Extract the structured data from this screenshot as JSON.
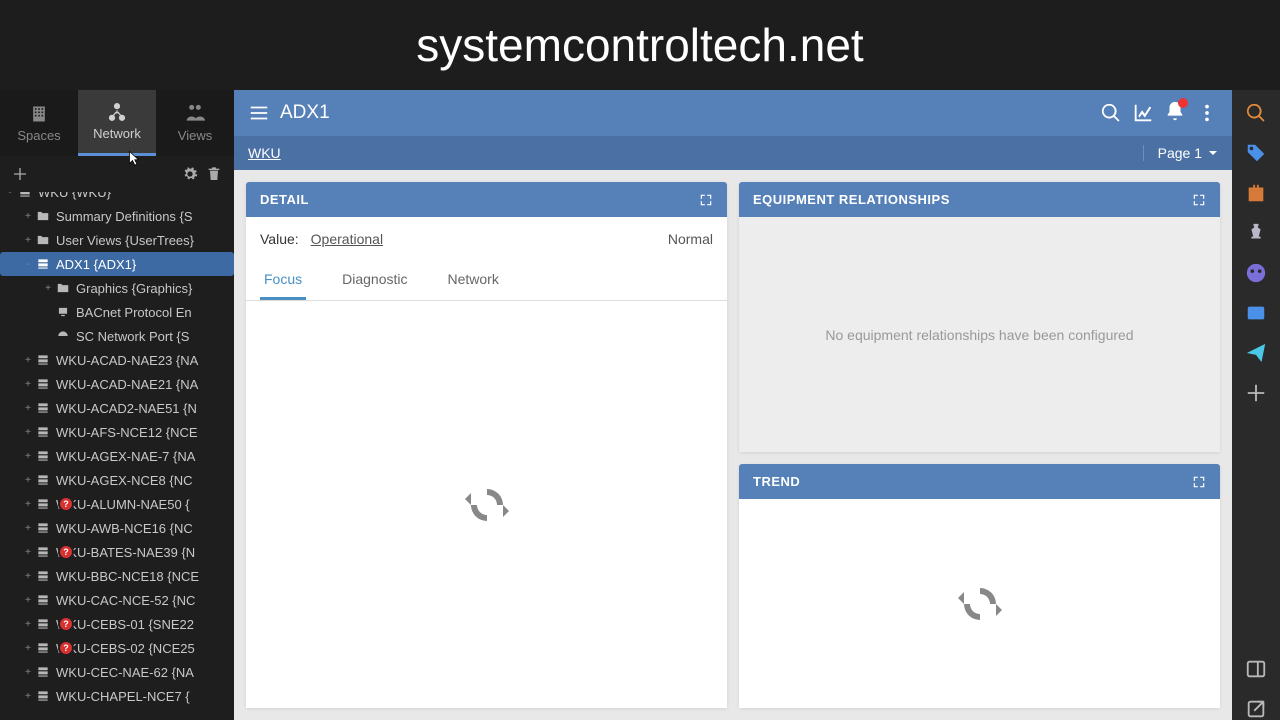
{
  "watermark": "systemcontroltech.net",
  "nav": {
    "spaces": "Spaces",
    "network": "Network",
    "views": "Views"
  },
  "tree": {
    "root": "WKU {WKU}",
    "items": [
      {
        "label": "Summary Definitions {S",
        "icon": "folder",
        "lvl": 1,
        "toggle": "+"
      },
      {
        "label": "User Views {UserTrees}",
        "icon": "folder",
        "lvl": 1,
        "toggle": "+"
      },
      {
        "label": "ADX1 {ADX1}",
        "icon": "server",
        "lvl": 1,
        "toggle": "-",
        "selected": true
      },
      {
        "label": "Graphics {Graphics}",
        "icon": "folder",
        "lvl": 2,
        "toggle": "+"
      },
      {
        "label": "BACnet Protocol En",
        "icon": "device",
        "lvl": 2,
        "toggle": ""
      },
      {
        "label": "SC Network Port {S",
        "icon": "gauge",
        "lvl": 2,
        "toggle": ""
      },
      {
        "label": "WKU-ACAD-NAE23 {NA",
        "icon": "server",
        "lvl": 1,
        "toggle": "+"
      },
      {
        "label": "WKU-ACAD-NAE21 {NA",
        "icon": "server",
        "lvl": 1,
        "toggle": "+"
      },
      {
        "label": "WKU-ACAD2-NAE51 {N",
        "icon": "server",
        "lvl": 1,
        "toggle": "+"
      },
      {
        "label": "WKU-AFS-NCE12 {NCE",
        "icon": "server",
        "lvl": 1,
        "toggle": "+"
      },
      {
        "label": "WKU-AGEX-NAE-7 {NA",
        "icon": "server",
        "lvl": 1,
        "toggle": "+"
      },
      {
        "label": "WKU-AGEX-NCE8 {NC",
        "icon": "server",
        "lvl": 1,
        "toggle": "+"
      },
      {
        "label": "WKU-ALUMN-NAE50 {",
        "icon": "server",
        "lvl": 1,
        "toggle": "+",
        "alert": true
      },
      {
        "label": "WKU-AWB-NCE16 {NC",
        "icon": "server",
        "lvl": 1,
        "toggle": "+"
      },
      {
        "label": "WKU-BATES-NAE39 {N",
        "icon": "server",
        "lvl": 1,
        "toggle": "+",
        "alert": true
      },
      {
        "label": "WKU-BBC-NCE18 {NCE",
        "icon": "server",
        "lvl": 1,
        "toggle": "+"
      },
      {
        "label": "WKU-CAC-NCE-52 {NC",
        "icon": "server",
        "lvl": 1,
        "toggle": "+"
      },
      {
        "label": "WKU-CEBS-01 {SNE22",
        "icon": "server",
        "lvl": 1,
        "toggle": "+",
        "alert": true
      },
      {
        "label": "WKU-CEBS-02 {NCE25",
        "icon": "server",
        "lvl": 1,
        "toggle": "+",
        "alert": true
      },
      {
        "label": "WKU-CEC-NAE-62 {NA",
        "icon": "server",
        "lvl": 1,
        "toggle": "+"
      },
      {
        "label": "WKU-CHAPEL-NCE7 {",
        "icon": "server",
        "lvl": 1,
        "toggle": "+"
      }
    ]
  },
  "header": {
    "title": "ADX1",
    "breadcrumb": "WKU",
    "page": "Page 1"
  },
  "panels": {
    "detail": {
      "title": "DETAIL",
      "value_label": "Value:",
      "value": "Operational",
      "status": "Normal",
      "tabs": [
        "Focus",
        "Diagnostic",
        "Network"
      ]
    },
    "relationships": {
      "title": "EQUIPMENT RELATIONSHIPS",
      "empty": "No equipment relationships have been configured"
    },
    "trend": {
      "title": "TREND"
    }
  }
}
